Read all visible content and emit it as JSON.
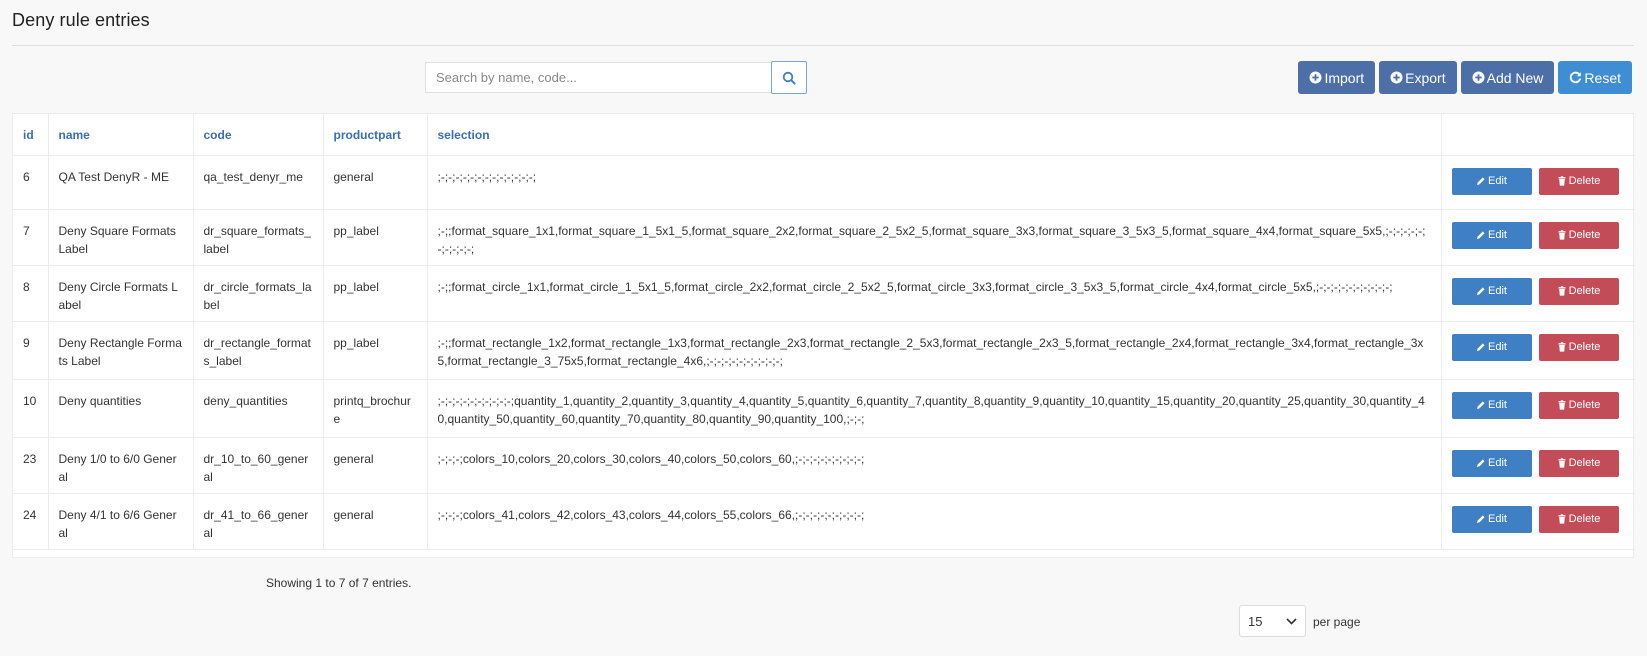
{
  "page": {
    "title": "Deny rule entries"
  },
  "search": {
    "placeholder": "Search by name, code..."
  },
  "toolbar": {
    "import_label": "Import",
    "export_label": "Export",
    "add_label": "Add New",
    "reset_label": "Reset"
  },
  "table": {
    "columns": {
      "id": "id",
      "name": "name",
      "code": "code",
      "productpart": "productpart",
      "selection": "selection"
    },
    "rows": [
      {
        "id": "6",
        "name": "QA Test DenyR - ME",
        "code": "qa_test_denyr_me",
        "productpart": "general",
        "selection": ";-;-;-;-;-;-;-;-;-;-;-;-;-;"
      },
      {
        "id": "7",
        "name": "Deny Square Formats Label",
        "code": "dr_square_formats_label",
        "productpart": "pp_label",
        "selection": ";-;;format_square_1x1,format_square_1_5x1_5,format_square_2x2,format_square_2_5x2_5,format_square_3x3,format_square_3_5x3_5,format_square_4x4,format_square_5x5,;-;-;-;-;-;-;-;-;-;-;"
      },
      {
        "id": "8",
        "name": "Deny Circle Formats Label",
        "code": "dr_circle_formats_label",
        "productpart": "pp_label",
        "selection": ";-;;format_circle_1x1,format_circle_1_5x1_5,format_circle_2x2,format_circle_2_5x2_5,format_circle_3x3,format_circle_3_5x3_5,format_circle_4x4,format_circle_5x5,;-;-;-;-;-;-;-;-;-;-;"
      },
      {
        "id": "9",
        "name": "Deny Rectangle Formats Label",
        "code": "dr_rectangle_formats_label",
        "productpart": "pp_label",
        "selection": ";-;;format_rectangle_1x2,format_rectangle_1x3,format_rectangle_2x3,format_rectangle_2_5x3,format_rectangle_2x3_5,format_rectangle_2x4,format_rectangle_3x4,format_rectangle_3x5,format_rectangle_3_75x5,format_rectangle_4x6,;-;-;-;-;-;-;-;-;-;-;"
      },
      {
        "id": "10",
        "name": "Deny quantities",
        "code": "deny_quantities",
        "productpart": "printq_brochure",
        "selection": ";-;-;-;-;-;-;-;-;-;-;quantity_1,quantity_2,quantity_3,quantity_4,quantity_5,quantity_6,quantity_7,quantity_8,quantity_9,quantity_10,quantity_15,quantity_20,quantity_25,quantity_30,quantity_40,quantity_50,quantity_60,quantity_70,quantity_80,quantity_90,quantity_100,;-;-;"
      },
      {
        "id": "23",
        "name": "Deny 1/0 to 6/0 General",
        "code": "dr_10_to_60_general",
        "productpart": "general",
        "selection": ";-;-;-;colors_10,colors_20,colors_30,colors_40,colors_50,colors_60,;-;-;-;-;-;-;-;-;-;"
      },
      {
        "id": "24",
        "name": "Deny 4/1 to 6/6 General",
        "code": "dr_41_to_66_general",
        "productpart": "general",
        "selection": ";-;-;-;colors_41,colors_42,colors_43,colors_44,colors_55,colors_66,;-;-;-;-;-;-;-;-;-;"
      }
    ],
    "edit_label": "Edit",
    "delete_label": "Delete"
  },
  "footer": {
    "summary": "Showing 1 to 7 of 7 entries.",
    "per_page_value": "15",
    "per_page_label": "per page"
  },
  "colors": {
    "primary_dark": "#4d6fa8",
    "primary_light": "#3f8dd3",
    "edit": "#3f7fc3",
    "delete": "#c24d58",
    "header_link": "#3a6fb0"
  },
  "icons": {
    "search": "search-icon",
    "import": "plus-circle-icon",
    "export": "plus-circle-icon",
    "add": "plus-circle-icon",
    "reset": "refresh-icon",
    "edit": "pencil-icon",
    "delete": "trash-icon",
    "select": "chevron-down-icon"
  }
}
